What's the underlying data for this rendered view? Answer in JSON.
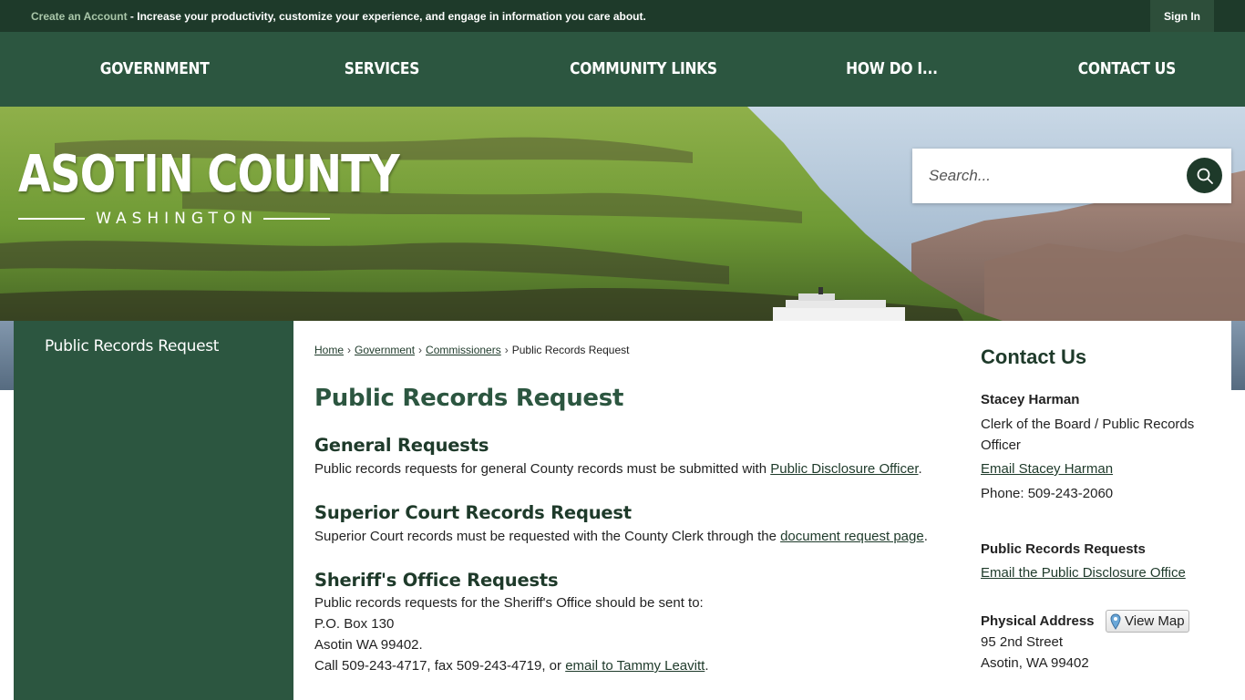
{
  "topbar": {
    "create_account": "Create an Account",
    "message": " - Increase your productivity, customize your experience, and engage in information you care about.",
    "sign_in": "Sign In"
  },
  "nav": {
    "items": [
      "GOVERNMENT",
      "SERVICES",
      "COMMUNITY LINKS",
      "HOW DO I...",
      "CONTACT US"
    ]
  },
  "logo": {
    "name": "ASOTIN COUNTY",
    "state": "WASHINGTON"
  },
  "search": {
    "placeholder": "Search..."
  },
  "sidebar": {
    "items": [
      "Public Records Request"
    ]
  },
  "breadcrumb": {
    "items": [
      "Home",
      "Government",
      "Commissioners"
    ],
    "current": "Public Records Request"
  },
  "page": {
    "title": "Public Records Request",
    "sections": [
      {
        "heading": "General Requests",
        "text": "Public records requests for general County records must be submitted with ",
        "link": "Public Disclosure Officer",
        "after": "."
      },
      {
        "heading": "Superior Court Records Request",
        "text": "Superior Court records must be requested with the County Clerk through the ",
        "link": "document request page",
        "after": "."
      },
      {
        "heading": "Sheriff's Office Requests",
        "line1": "Public records requests for the Sheriff's Office should be sent to:",
        "line2": "P.O. Box 130",
        "line3": "Asotin WA 99402.",
        "line4_pre": "Call 509-243-4717, fax 509-243-4719, or ",
        "line4_link": "email to Tammy Leavitt",
        "line4_post": "."
      }
    ]
  },
  "contact": {
    "title": "Contact Us",
    "name": "Stacey Harman",
    "role_line1": "Clerk of the Board / Public Records",
    "role_line2": "Officer",
    "email_link": "Email Stacey Harman",
    "phone": "Phone: 509-243-2060",
    "records_heading": "Public Records Requests",
    "records_link": "Email the Public Disclosure Office",
    "address_heading": "Physical Address",
    "view_map": "View Map",
    "address_line1": "95 2nd Street",
    "address_line2": "Asotin, WA 99402"
  }
}
